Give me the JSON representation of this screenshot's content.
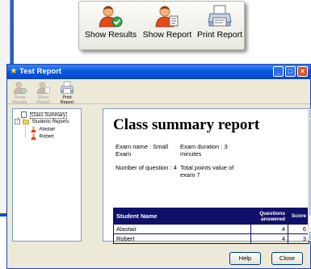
{
  "toolbar_panel": {
    "buttons": [
      {
        "label": "Show Results",
        "icon": "show-results-icon"
      },
      {
        "label": "Show Report",
        "icon": "show-report-icon"
      },
      {
        "label": "Print Report",
        "icon": "print-report-icon"
      }
    ]
  },
  "dialog": {
    "title": "Test Report",
    "window_controls": {
      "minimize": "_",
      "maximize": "□",
      "close": "×"
    },
    "toolbar": [
      {
        "label": "Show Results",
        "enabled": false
      },
      {
        "label": "Show Report",
        "enabled": false
      },
      {
        "label": "Print Report",
        "enabled": true
      }
    ],
    "tree": {
      "root": {
        "label": "Class Summary"
      },
      "group": {
        "label": "Students Reports",
        "expander": "-"
      },
      "students": [
        {
          "label": "Alastair"
        },
        {
          "label": "Robert"
        }
      ]
    },
    "report": {
      "title": "Class summary report",
      "exam_name": "Exam name : Small Exam",
      "exam_duration": "Exam duration : 3 minutes",
      "num_questions": "Number of question : 4",
      "total_points": "Total points value of exam 7",
      "table": {
        "headers": {
          "student": "Student Name",
          "answered": "Questions answered",
          "score": "Score"
        },
        "rows": [
          {
            "student": "Alastair",
            "answered": "4",
            "score": "6"
          },
          {
            "student": "Robert",
            "answered": "4",
            "score": "3"
          }
        ]
      },
      "scroll": {
        "up": "▲",
        "down": "▼"
      }
    },
    "buttons": {
      "help": "Help",
      "close": "Close"
    }
  },
  "colors": {
    "titlebar": "#0a5be0",
    "table_header": "#10106a",
    "dialog_bg": "#ece9d8"
  }
}
